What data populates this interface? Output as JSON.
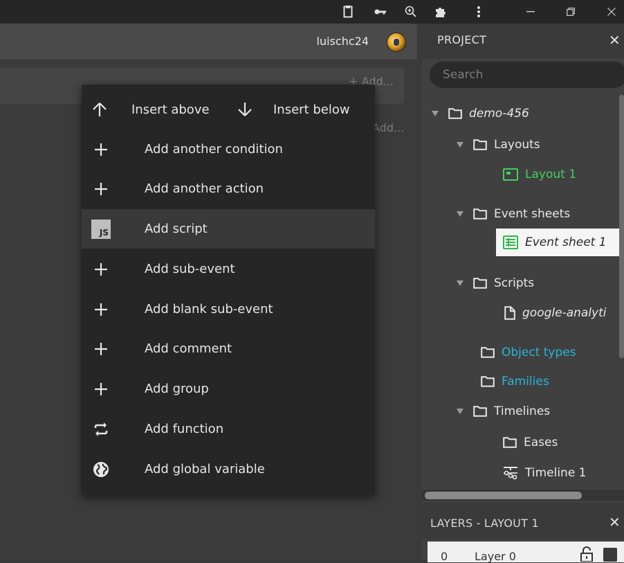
{
  "window": {
    "controls": [
      "minimize-icon",
      "restore-icon",
      "close-icon"
    ],
    "toolbar_icons": [
      "clipboard-icon",
      "key-icon",
      "zoom-icon",
      "puzzle-icon",
      "more-vert-icon"
    ]
  },
  "editor": {
    "user_name": "luischc24",
    "add_ghost_1": "+ Add...",
    "add_ghost_2": "Add..."
  },
  "context_menu": {
    "insert_above": "Insert above",
    "insert_below": "Insert below",
    "items": [
      {
        "label": "Add another condition",
        "icon": "plus-icon"
      },
      {
        "label": "Add another action",
        "icon": "plus-icon"
      },
      {
        "label": "Add script",
        "icon": "js-icon",
        "badge": "JS"
      },
      {
        "label": "Add sub-event",
        "icon": "plus-icon"
      },
      {
        "label": "Add blank sub-event",
        "icon": "plus-icon"
      },
      {
        "label": "Add comment",
        "icon": "plus-icon"
      },
      {
        "label": "Add group",
        "icon": "plus-icon"
      },
      {
        "label": "Add function",
        "icon": "repeat-icon"
      },
      {
        "label": "Add global variable",
        "icon": "globe-icon"
      }
    ],
    "highlighted_index": 2
  },
  "project": {
    "title": "PROJECT",
    "close": "✕",
    "search_placeholder": "Search",
    "tree": {
      "root": "demo-456",
      "layouts": "Layouts",
      "layout_1": "Layout 1",
      "event_sheets": "Event sheets",
      "event_sheet_1": "Event sheet 1",
      "scripts": "Scripts",
      "script_file": "google-analyti",
      "object_types": "Object types",
      "families": "Families",
      "timelines": "Timelines",
      "eases": "Eases",
      "timeline_1": "Timeline 1"
    },
    "colors": {
      "green": "#43d15a",
      "blue": "#2bb5d6"
    }
  },
  "layers": {
    "title": "LAYERS - LAYOUT 1",
    "close": "✕",
    "row": {
      "index": "0",
      "name": "Layer 0"
    }
  }
}
